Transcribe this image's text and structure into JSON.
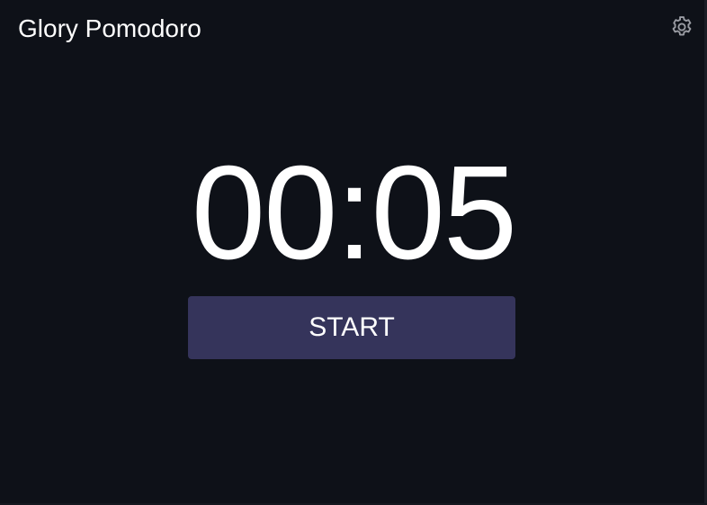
{
  "app": {
    "title": "Glory Pomodoro",
    "settings_icon": "gear-icon"
  },
  "timer": {
    "display": "00:05"
  },
  "controls": {
    "start_label": "START"
  },
  "colors": {
    "background": "#0e1118",
    "button": "#35345b",
    "text": "#ffffff",
    "icon": "#9a9ca3"
  }
}
